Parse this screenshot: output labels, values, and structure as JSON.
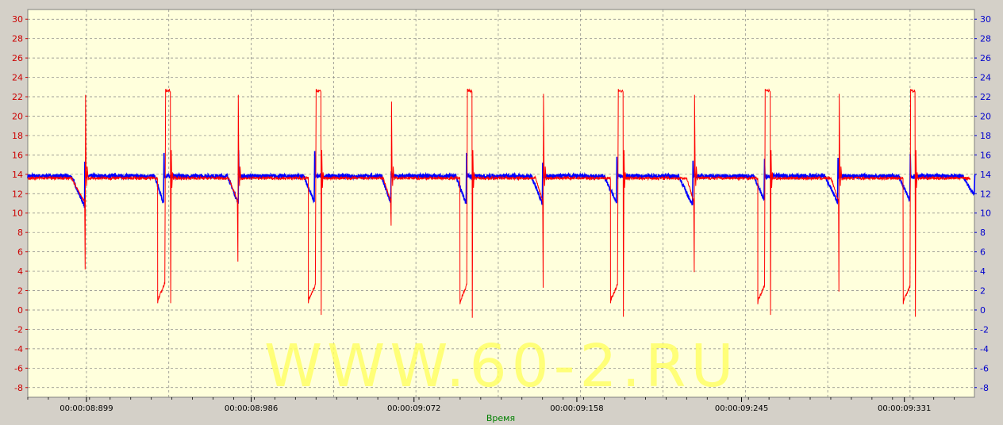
{
  "chart_data": {
    "type": "line",
    "title": "",
    "xlabel": "Время",
    "ylabel": "",
    "ylim": [
      -9,
      31
    ],
    "y_ticks": [
      30,
      28,
      26,
      24,
      22,
      20,
      18,
      16,
      14,
      12,
      10,
      8,
      6,
      4,
      2,
      0,
      -2,
      -4,
      -6,
      -8
    ],
    "y_tick_labels": [
      "30",
      "28",
      "26",
      "24",
      "22",
      "20",
      "18",
      "16",
      "14",
      "12",
      "10",
      "8",
      "6",
      "4",
      "2",
      "0",
      "-2",
      "-4",
      "-6",
      "-8"
    ],
    "x_ticks": [
      "00:00:08:899",
      "00:00:08:986",
      "00:00:09:072",
      "00:00:09:158",
      "00:00:09:245",
      "00:00:09:331"
    ],
    "x_tick_values_ms": [
      8899,
      8986,
      9072,
      9158,
      9245,
      9331
    ],
    "xlim_ms": [
      8868,
      9368
    ],
    "grid": true,
    "background": "#ffffdc",
    "watermark": "WWW.60-2.RU",
    "series": [
      {
        "axis": "left",
        "color": "#ff0000",
        "cycles": [
          {
            "start": 8891.0,
            "spike": 8898.5,
            "spike_low": 4.2,
            "spike_high": 22.2,
            "fall": 8936.6,
            "mid_low": 0.7,
            "mid_high": 2.8,
            "open": 8940.8,
            "open_high": 22.8,
            "end": 8943.5,
            "end_low": 0.7
          },
          {
            "start": 8974.2,
            "spike": 8979.2,
            "spike_low": 5.0,
            "spike_high": 22.2,
            "fall": 9016.2,
            "mid_low": 0.7,
            "mid_high": 2.6,
            "open": 9020.3,
            "open_high": 22.8,
            "end": 9023.0,
            "end_low": -0.5
          },
          {
            "start": 9055.7,
            "spike": 9060.1,
            "spike_low": 8.7,
            "spike_high": 21.5,
            "fall": 9096.3,
            "mid_low": 0.6,
            "mid_high": 2.6,
            "open": 9100.2,
            "open_high": 22.8,
            "end": 9102.8,
            "end_low": -0.8
          },
          {
            "start": 9136.2,
            "spike": 9140.4,
            "spike_low": 2.3,
            "spike_high": 22.3,
            "fall": 9175.8,
            "mid_low": 0.7,
            "mid_high": 2.6,
            "open": 9179.9,
            "open_high": 22.8,
            "end": 9182.6,
            "end_low": -0.7
          },
          {
            "start": 9216.0,
            "spike": 9220.2,
            "spike_low": 3.9,
            "spike_high": 22.2,
            "fall": 9253.6,
            "mid_low": 0.6,
            "mid_high": 2.6,
            "open": 9257.5,
            "open_high": 22.8,
            "end": 9260.3,
            "end_low": -0.5
          },
          {
            "start": 9292.3,
            "spike": 9296.6,
            "spike_low": 1.9,
            "spike_high": 22.3,
            "fall": 9330.4,
            "mid_low": 0.6,
            "mid_high": 2.5,
            "open": 9334.3,
            "open_high": 22.8,
            "end": 9336.8,
            "end_low": -0.7
          }
        ]
      },
      {
        "axis": "right",
        "color": "#0000ff",
        "level": 13.8,
        "dips": [
          {
            "start": 8891.0,
            "bottom": 8898.0,
            "bottom_value": 10.7,
            "spike_value": 15.3
          },
          {
            "start": 8935.0,
            "bottom": 8939.8,
            "bottom_value": 10.9,
            "spike_value": 16.2
          },
          {
            "start": 8973.5,
            "bottom": 8979.2,
            "bottom_value": 11.0,
            "spike_value": 16.5
          },
          {
            "start": 9013.8,
            "bottom": 9019.4,
            "bottom_value": 11.1,
            "spike_value": 16.4
          },
          {
            "start": 9054.8,
            "bottom": 9059.8,
            "bottom_value": 11.0,
            "spike_value": 14.3
          },
          {
            "start": 9094.0,
            "bottom": 9099.6,
            "bottom_value": 11.0,
            "spike_value": 16.2
          },
          {
            "start": 9134.0,
            "bottom": 9139.8,
            "bottom_value": 11.0,
            "spike_value": 15.2
          },
          {
            "start": 9172.5,
            "bottom": 9179.0,
            "bottom_value": 11.1,
            "spike_value": 15.8
          },
          {
            "start": 9211.8,
            "bottom": 9219.2,
            "bottom_value": 10.8,
            "spike_value": 15.4
          },
          {
            "start": 9251.5,
            "bottom": 9257.0,
            "bottom_value": 11.3,
            "spike_value": 15.6
          },
          {
            "start": 9289.0,
            "bottom": 9295.8,
            "bottom_value": 11.1,
            "spike_value": 15.7
          },
          {
            "start": 9328.0,
            "bottom": 9334.0,
            "bottom_value": 11.2,
            "spike_value": 16.1
          },
          {
            "start": 9362.0,
            "bottom": 9368.0,
            "bottom_value": 11.8,
            "spike_value": 13.8
          }
        ]
      }
    ]
  }
}
